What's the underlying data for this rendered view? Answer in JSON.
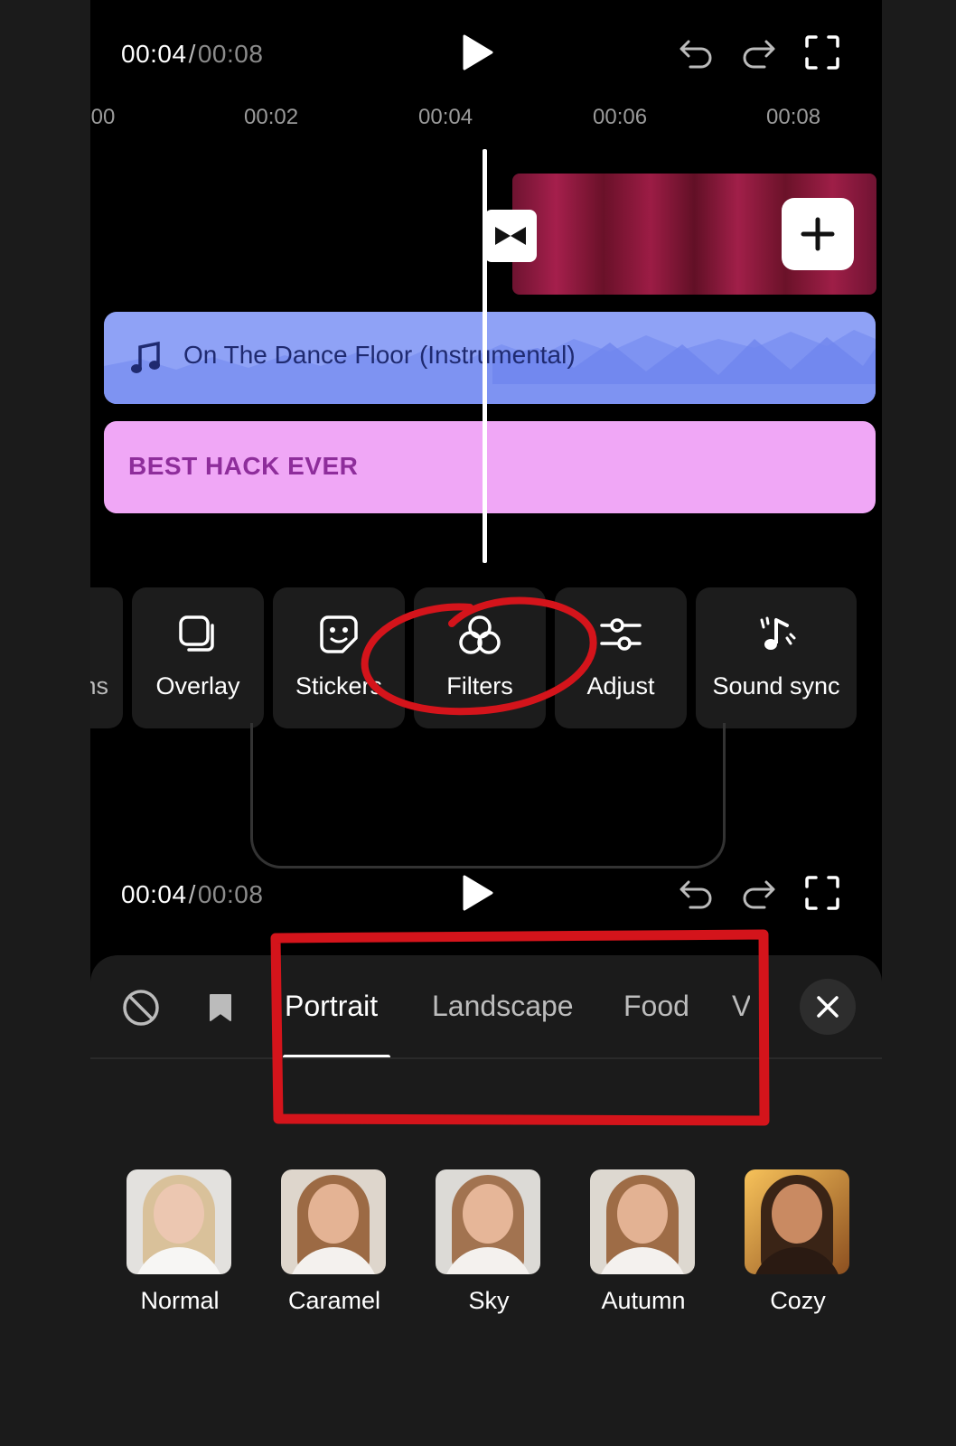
{
  "top_bar": {
    "current_time": "00:04",
    "separator": "/",
    "total_time": "00:08"
  },
  "ruler": {
    "ticks": [
      ":00",
      "00:02",
      "00:04",
      "00:06",
      "00:08"
    ]
  },
  "timeline": {
    "audio_track_label": "On The Dance Floor (Instrumental)",
    "text_track_label": "BEST HACK EVER"
  },
  "toolbar": {
    "partial_left_label": "ns",
    "items": [
      {
        "label": "Overlay",
        "icon": "overlay-icon"
      },
      {
        "label": "Stickers",
        "icon": "sticker-icon"
      },
      {
        "label": "Filters",
        "icon": "filters-icon"
      },
      {
        "label": "Adjust",
        "icon": "adjust-icon"
      },
      {
        "label": "Sound sync",
        "icon": "sound-sync-icon"
      }
    ]
  },
  "bottom_bar": {
    "current_time": "00:04",
    "separator": "/",
    "total_time": "00:08"
  },
  "filter_panel": {
    "tabs": [
      {
        "label": "Portrait",
        "active": true
      },
      {
        "label": "Landscape",
        "active": false
      },
      {
        "label": "Food",
        "active": false
      },
      {
        "label": "V",
        "active": false
      }
    ],
    "filters": [
      {
        "label": "Normal"
      },
      {
        "label": "Caramel"
      },
      {
        "label": "Sky"
      },
      {
        "label": "Autumn"
      },
      {
        "label": "Cozy"
      }
    ]
  },
  "colors": {
    "audio_track": "#8fa2f6",
    "text_track": "#f0a7f6",
    "video_clip": "#8e1a3e",
    "annotation_red": "#d4141b"
  }
}
